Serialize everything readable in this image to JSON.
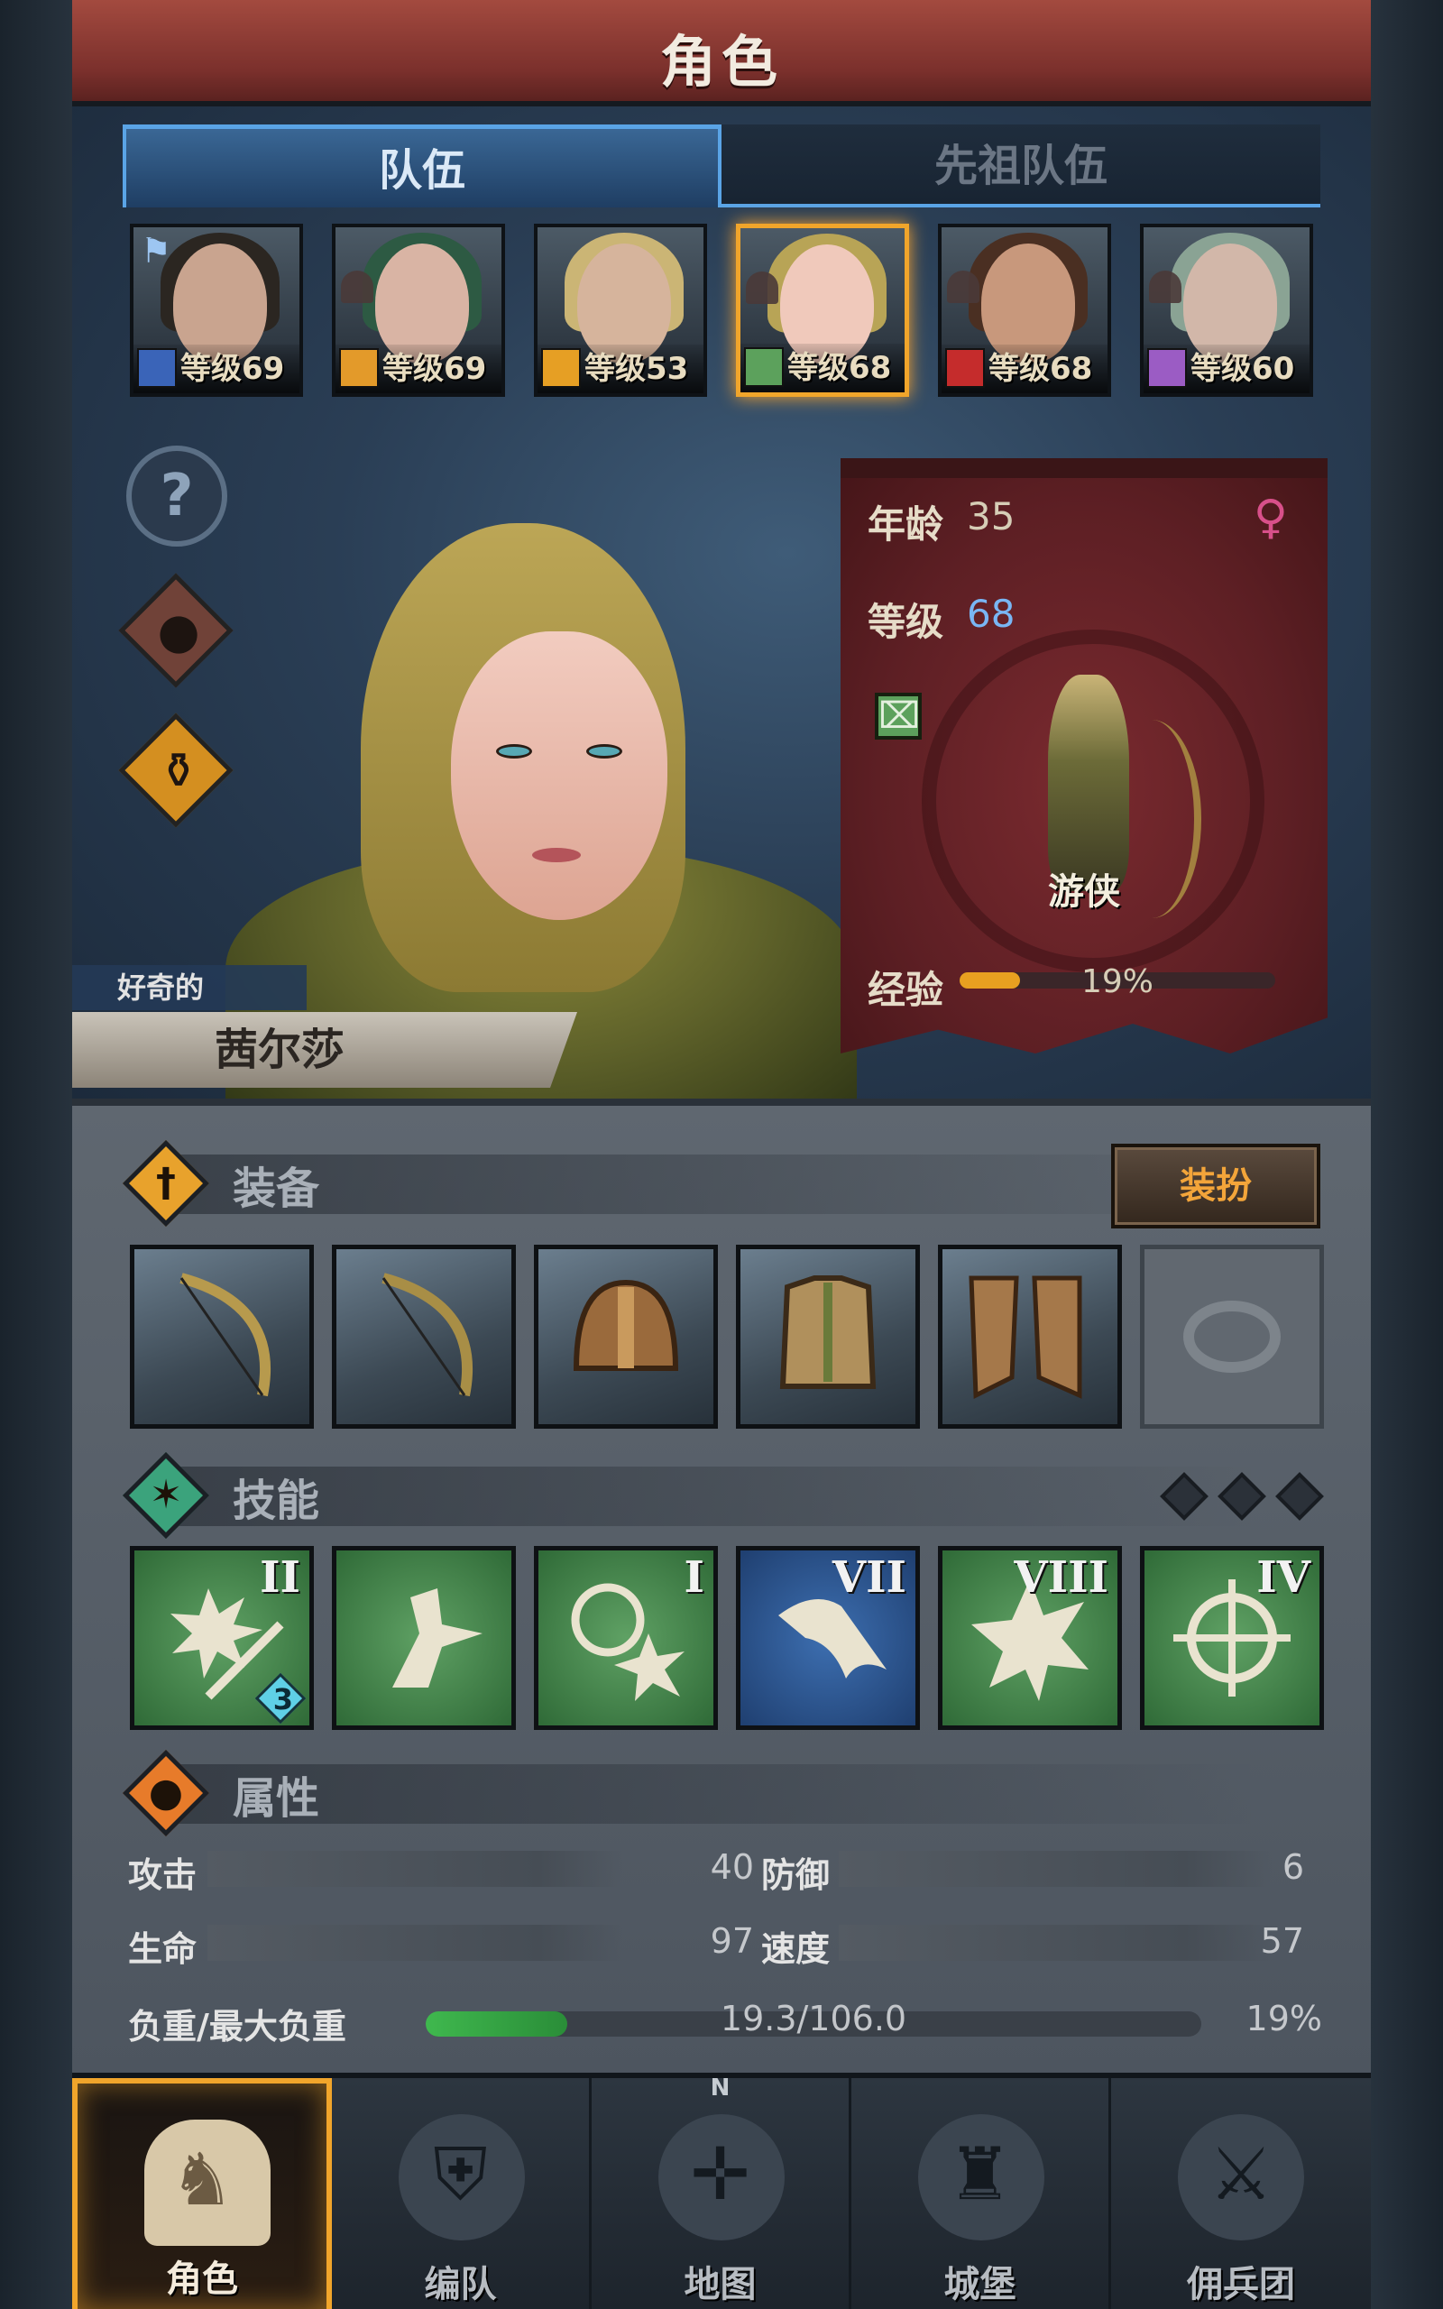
{
  "header": {
    "title": "角色"
  },
  "tabs": [
    {
      "label": "队伍",
      "active": true
    },
    {
      "label": "先祖队伍",
      "active": false
    }
  ],
  "roster": [
    {
      "level": "等级69",
      "class_icon": "sword-icon",
      "class_color": "#3a64b8",
      "hair": "#2b2621",
      "skin": "#c9a48f",
      "leader": true,
      "active": false
    },
    {
      "level": "等级69",
      "class_icon": "bow-icon",
      "class_color": "#e39a2a",
      "hair": "#2d5a43",
      "skin": "#d9b4a4",
      "leader": false,
      "active": false
    },
    {
      "level": "等级53",
      "class_icon": "shield-icon",
      "class_color": "#e69f24",
      "hair": "#cbb575",
      "skin": "#d6b49c",
      "leader": false,
      "active": false
    },
    {
      "level": "等级68",
      "class_icon": "bow-icon",
      "class_color": "#5ca15c",
      "hair": "#b8a456",
      "skin": "#f0c9bb",
      "leader": false,
      "active": true
    },
    {
      "level": "等级68",
      "class_icon": "horse-icon",
      "class_color": "#c52c2c",
      "hair": "#4a2f22",
      "skin": "#c8987c",
      "leader": false,
      "active": false
    },
    {
      "level": "等级60",
      "class_icon": "staff-icon",
      "class_color": "#9b5cc4",
      "hair": "#8aa394",
      "skin": "#d2b7a9",
      "leader": false,
      "active": false
    }
  ],
  "left_icons": [
    "question-icon",
    "group-icon",
    "potion-icon"
  ],
  "character": {
    "trait": "好奇的",
    "name": "茜尔莎",
    "age_label": "年龄",
    "age": "35",
    "level_label": "等级",
    "level": "68",
    "gender_symbol": "♀",
    "class_name": "游侠",
    "xp_label": "经验",
    "xp_percent": "19%",
    "xp_fraction": 0.19
  },
  "equipment": {
    "title": "装备",
    "dress_label": "装扮",
    "slots": [
      {
        "name": "bow-1",
        "icon": "bow-icon",
        "empty": false
      },
      {
        "name": "bow-2",
        "icon": "bow-icon",
        "empty": false
      },
      {
        "name": "helmet",
        "icon": "helmet-icon",
        "empty": false
      },
      {
        "name": "armor",
        "icon": "armor-icon",
        "empty": false
      },
      {
        "name": "boots",
        "icon": "boots-icon",
        "empty": false
      },
      {
        "name": "ring",
        "icon": "ring-icon",
        "empty": true
      }
    ]
  },
  "skills": {
    "title": "技能",
    "slots": [
      {
        "numeral": "II",
        "icon": "sword-burst-icon",
        "color": "green",
        "badge": "3"
      },
      {
        "numeral": "",
        "icon": "dash-icon",
        "color": "green",
        "badge": ""
      },
      {
        "numeral": "I",
        "icon": "target-burst-icon",
        "color": "green",
        "badge": ""
      },
      {
        "numeral": "VII",
        "icon": "horse-head-icon",
        "color": "blue",
        "badge": ""
      },
      {
        "numeral": "VIII",
        "icon": "burst-icon",
        "color": "green",
        "badge": ""
      },
      {
        "numeral": "IV",
        "icon": "crosshair-icon",
        "color": "green",
        "badge": ""
      }
    ]
  },
  "attributes": {
    "title": "属性",
    "attack_label": "攻击",
    "attack": "40",
    "defense_label": "防御",
    "defense": "6",
    "hp_label": "生命",
    "hp": "97",
    "speed_label": "速度",
    "speed": "57",
    "load_label": "负重/最大负重",
    "load_value": "19.3/106.0",
    "load_percent": "19%",
    "load_fraction": 0.182
  },
  "nav": [
    {
      "label": "角色",
      "icon": "knight-icon",
      "active": true
    },
    {
      "label": "编队",
      "icon": "helmet-shield-icon",
      "active": false
    },
    {
      "label": "地图",
      "icon": "compass-icon",
      "active": false
    },
    {
      "label": "城堡",
      "icon": "castle-icon",
      "active": false
    },
    {
      "label": "佣兵团",
      "icon": "mercenary-icon",
      "active": false
    }
  ],
  "compass_letter": "N"
}
